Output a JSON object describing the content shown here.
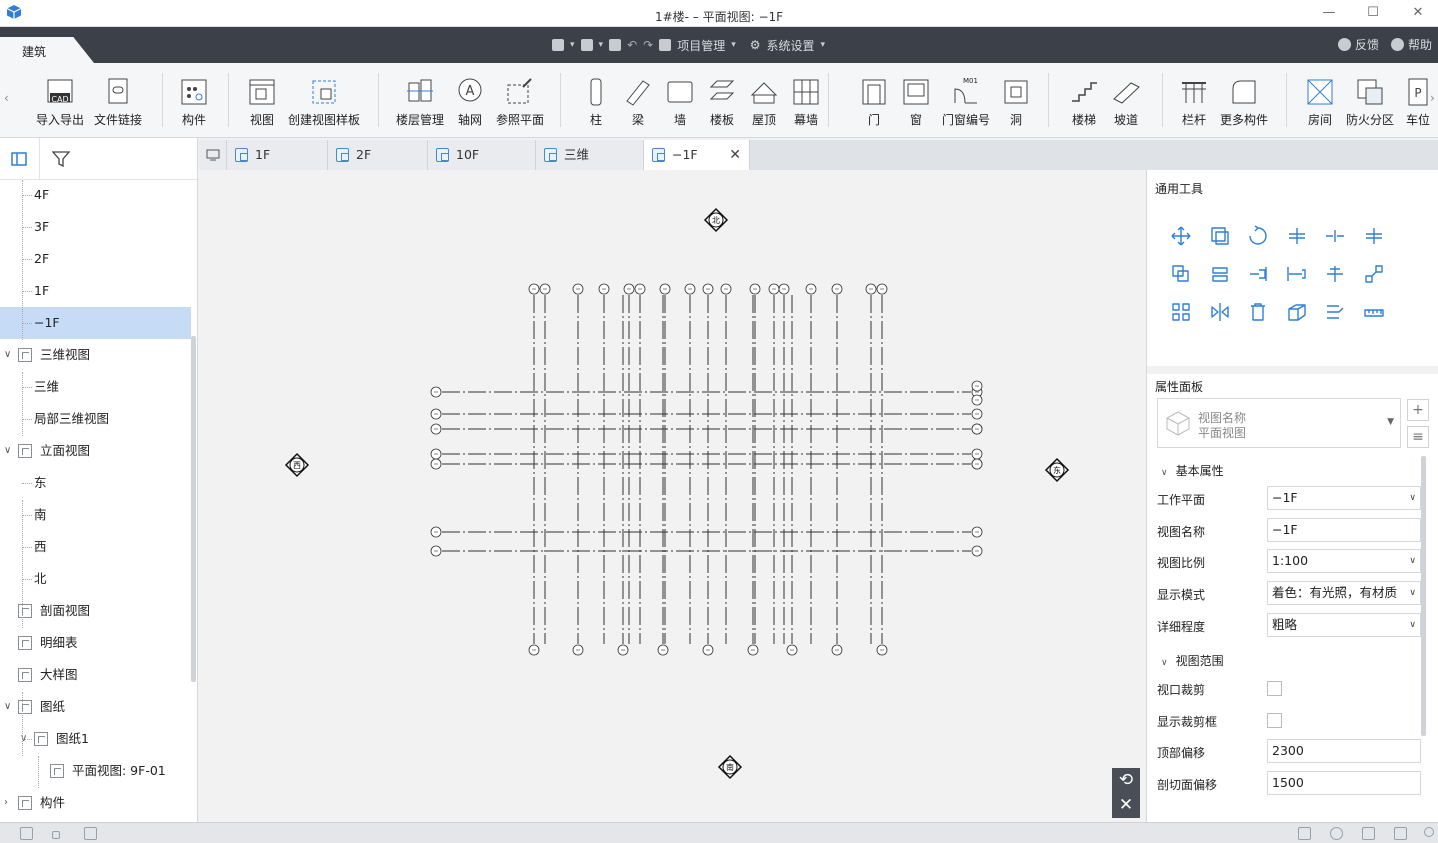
{
  "window": {
    "title": "1#楼- – 平面视图: −1F",
    "controls": [
      "—",
      "☐",
      "✕"
    ]
  },
  "menubar": {
    "active_tab": "建筑",
    "project_mgmt": "项目管理",
    "system_settings": "系统设置",
    "feedback": "反馈",
    "help": "帮助"
  },
  "ribbon": {
    "items": [
      {
        "label": "导入导出",
        "icon": "cad-import-icon"
      },
      {
        "label": "文件链接",
        "icon": "file-link-icon"
      },
      {
        "label": "构件",
        "icon": "component-icon"
      },
      {
        "label": "视图",
        "icon": "view-icon"
      },
      {
        "label": "创建视图样板",
        "icon": "view-template-icon"
      },
      {
        "label": "楼层管理",
        "icon": "floor-manage-icon"
      },
      {
        "label": "轴网",
        "icon": "grid-axis-icon"
      },
      {
        "label": "参照平面",
        "icon": "ref-plane-icon"
      },
      {
        "label": "柱",
        "icon": "column-icon"
      },
      {
        "label": "梁",
        "icon": "beam-icon"
      },
      {
        "label": "墙",
        "icon": "wall-icon"
      },
      {
        "label": "楼板",
        "icon": "slab-icon"
      },
      {
        "label": "屋顶",
        "icon": "roof-icon"
      },
      {
        "label": "幕墙",
        "icon": "curtain-wall-icon"
      },
      {
        "label": "门",
        "icon": "door-icon"
      },
      {
        "label": "窗",
        "icon": "window-icon"
      },
      {
        "label": "门窗编号",
        "icon": "door-window-tag-icon"
      },
      {
        "label": "洞",
        "icon": "opening-icon"
      },
      {
        "label": "楼梯",
        "icon": "stair-icon"
      },
      {
        "label": "坡道",
        "icon": "ramp-icon"
      },
      {
        "label": "栏杆",
        "icon": "railing-icon"
      },
      {
        "label": "更多构件",
        "icon": "more-components-icon"
      },
      {
        "label": "房间",
        "icon": "room-icon"
      },
      {
        "label": "防火分区",
        "icon": "fire-zone-icon"
      },
      {
        "label": "车位",
        "icon": "parking-icon"
      }
    ],
    "cad_badge": "CAD",
    "door_tag_badge": "M01"
  },
  "tree": {
    "items": [
      {
        "label": "4F",
        "level": 2,
        "selected": false
      },
      {
        "label": "3F",
        "level": 2,
        "selected": false
      },
      {
        "label": "2F",
        "level": 2,
        "selected": false
      },
      {
        "label": "1F",
        "level": 2,
        "selected": false
      },
      {
        "label": "−1F",
        "level": 2,
        "selected": true
      },
      {
        "label": "三维视图",
        "level": 1,
        "expanded": true
      },
      {
        "label": "三维",
        "level": 2
      },
      {
        "label": "局部三维视图",
        "level": 2
      },
      {
        "label": "立面视图",
        "level": 1,
        "expanded": true
      },
      {
        "label": "东",
        "level": 2
      },
      {
        "label": "南",
        "level": 2
      },
      {
        "label": "西",
        "level": 2
      },
      {
        "label": "北",
        "level": 2
      },
      {
        "label": "剖面视图",
        "level": 1
      },
      {
        "label": "明细表",
        "level": 1
      },
      {
        "label": "大样图",
        "level": 1
      },
      {
        "label": "图纸",
        "level": 1,
        "expanded": true
      },
      {
        "label": "图纸1",
        "level": 2,
        "expanded": true
      },
      {
        "label": "平面视图: 9F-01",
        "level": 3
      },
      {
        "label": "构件",
        "level": 1,
        "collapsed": true
      }
    ]
  },
  "doc_tabs": [
    {
      "label": "1F",
      "active": false
    },
    {
      "label": "2F",
      "active": false
    },
    {
      "label": "10F",
      "active": false
    },
    {
      "label": "三维",
      "active": false
    },
    {
      "label": "−1F",
      "active": true
    }
  ],
  "canvas": {
    "elevation_marks": {
      "north": "北",
      "south": "南",
      "west": "西",
      "east": "东"
    }
  },
  "right_panel": {
    "tools_title": "通用工具",
    "props_title": "属性面板",
    "type_selector": {
      "line1": "视图名称",
      "line2": "平面视图"
    },
    "group_basic": "基本属性",
    "group_range": "视图范围",
    "props": [
      {
        "key": "工作平面",
        "value": "−1F",
        "kind": "select"
      },
      {
        "key": "视图名称",
        "value": "−1F",
        "kind": "text"
      },
      {
        "key": "视图比例",
        "value": "1:100",
        "kind": "select"
      },
      {
        "key": "显示模式",
        "value": "着色：有光照，有材质",
        "kind": "select"
      },
      {
        "key": "详细程度",
        "value": "粗略",
        "kind": "select"
      }
    ],
    "range_props": [
      {
        "key": "视口裁剪",
        "checked": false,
        "kind": "checkbox"
      },
      {
        "key": "显示裁剪框",
        "checked": false,
        "kind": "checkbox"
      },
      {
        "key": "顶部偏移",
        "value": "2300",
        "kind": "text"
      },
      {
        "key": "剖切面偏移",
        "value": "1500",
        "kind": "text"
      }
    ]
  },
  "colors": {
    "menubar": "#3b4049",
    "selection": "#c6dcf6",
    "accent": "#4a86c8"
  }
}
